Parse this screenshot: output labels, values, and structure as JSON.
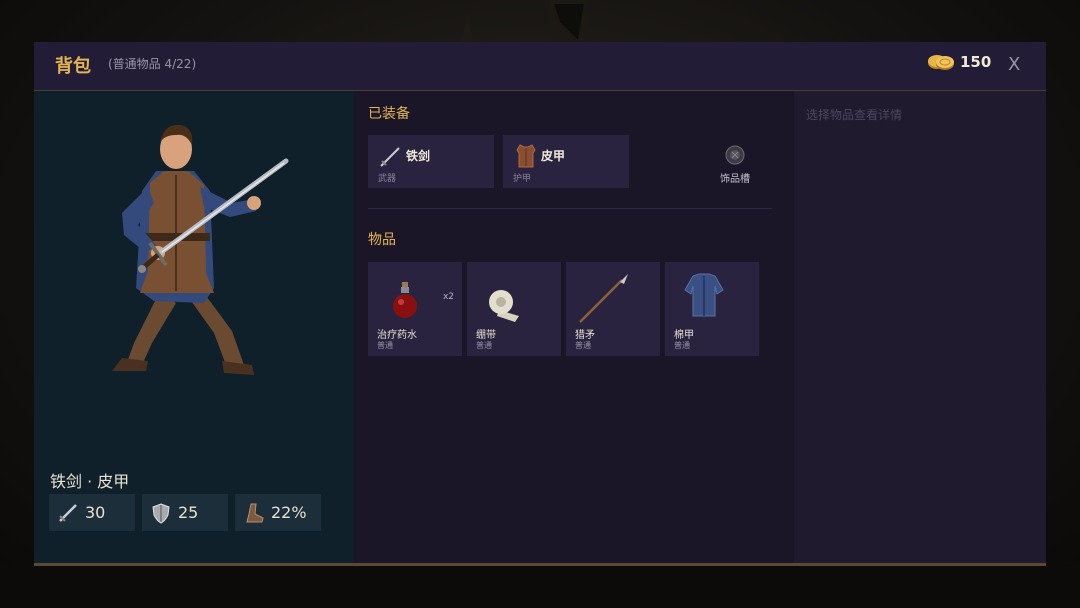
{
  "header": {
    "title": "背包",
    "subtitle": "(普通物品 4/22)",
    "gold": "150",
    "close_label": "X"
  },
  "character": {
    "loadout_name": "铁剑 · 皮甲",
    "stats": [
      {
        "icon": "sword-icon",
        "value": "30"
      },
      {
        "icon": "shield-icon",
        "value": "25"
      },
      {
        "icon": "boot-icon",
        "value": "22%"
      }
    ]
  },
  "equipped": {
    "label": "已装备",
    "slots": [
      {
        "name": "铁剑",
        "type": "武器",
        "icon": "sword-icon"
      },
      {
        "name": "皮甲",
        "type": "护甲",
        "icon": "leather-armor-icon"
      },
      {
        "name": "",
        "type": "饰品槽",
        "icon": "accessory-icon"
      }
    ]
  },
  "inventory": {
    "label": "物品",
    "items": [
      {
        "name": "治疗药水",
        "rarity": "普通",
        "qty": "x2",
        "icon": "potion-icon"
      },
      {
        "name": "绷带",
        "rarity": "普通",
        "qty": "",
        "icon": "bandage-icon"
      },
      {
        "name": "猎矛",
        "rarity": "普通",
        "qty": "",
        "icon": "spear-icon"
      },
      {
        "name": "棉甲",
        "rarity": "普通",
        "qty": "",
        "icon": "gambeson-icon"
      }
    ]
  },
  "detail": {
    "hint": "选择物品查看详情"
  },
  "colors": {
    "accent_gold": "#e3b450",
    "panel_bg": "#1a1628",
    "card_bg": "#2a2340",
    "character_bg": "#10202a"
  }
}
